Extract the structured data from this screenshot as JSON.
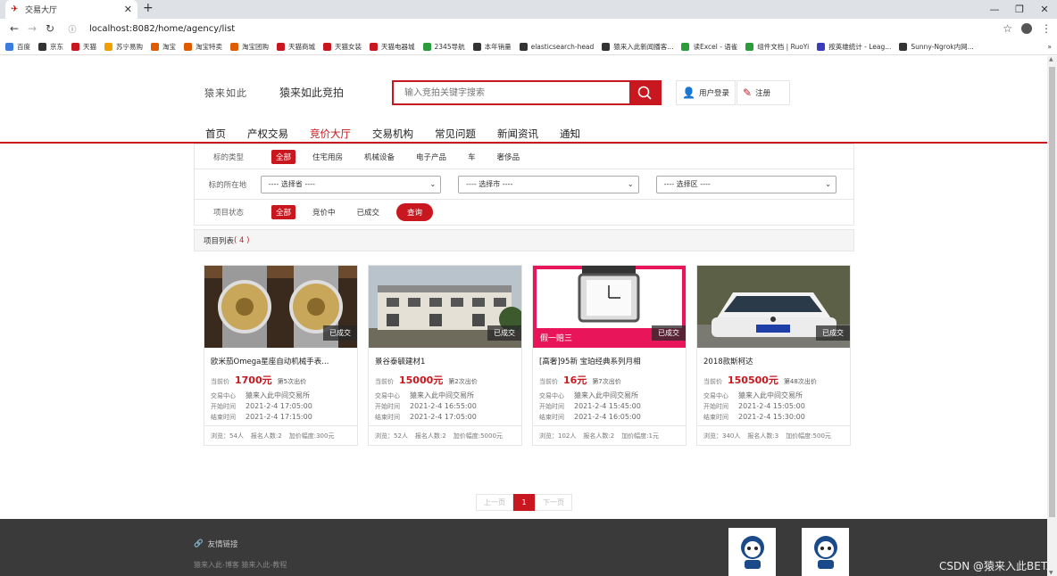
{
  "browser": {
    "tab_title": "交易大厅",
    "url": "localhost:8082/home/agency/list",
    "bookmarks": [
      "百度",
      "京东",
      "天猫",
      "苏宁易购",
      "淘宝",
      "淘宝特卖",
      "淘宝团购",
      "天猫商城",
      "天猫女装",
      "天猫电器城",
      "2345导航",
      "本年销量",
      "elasticsearch-head",
      "猿来入此新闻播客...",
      "读Excel - 语雀",
      "组件文档 | RuoYi",
      "按英雄统计 - Leag...",
      "Sunny-Ngrok内网..."
    ],
    "bookmarks_more": "»",
    "colors": {
      "accent": "#c8171e"
    }
  },
  "header": {
    "logo_text": "猿来如此",
    "site_name": "猿来如此竞拍",
    "search_placeholder": "输入竞拍关键字搜索",
    "login_label": "用户登录",
    "register_label": "注册"
  },
  "nav": [
    "首页",
    "产权交易",
    "竞价大厅",
    "交易机构",
    "常见问题",
    "新闻资讯",
    "通知"
  ],
  "filters": {
    "type_label": "标的类型",
    "types": [
      "全部",
      "住宅用房",
      "机械设备",
      "电子产品",
      "车",
      "奢侈品"
    ],
    "location_label": "标的所在地",
    "province": "---- 选择省 ----",
    "city": "---- 选择市 ----",
    "district": "---- 选择区 ----",
    "status_label": "项目状态",
    "statuses": [
      "全部",
      "竞价中",
      "已成交"
    ],
    "query_label": "查询"
  },
  "list": {
    "label": "项目列表",
    "count": "( 4 )"
  },
  "cards": [
    {
      "title": "欧米茄Omega星座自动机械手表...",
      "badge": "已成交",
      "price_label": "当前价",
      "price": "1700元",
      "bids": "第5次出价",
      "center_label": "交易中心",
      "center": "猿来入此中间交易所",
      "start_label": "开始时间",
      "start": "2021-2-4 17:05:00",
      "end_label": "结束时间",
      "end": "2021-2-4 17:15:00",
      "views": "浏览：54人",
      "signups": "报名人数:2",
      "step": "加价幅度:300元"
    },
    {
      "title": "景谷泰毓建材1",
      "badge": "已成交",
      "price_label": "当前价",
      "price": "15000元",
      "bids": "第2次出价",
      "center_label": "交易中心",
      "center": "猿来入此中间交易所",
      "start_label": "开始时间",
      "start": "2021-2-4 16:55:00",
      "end_label": "结束时间",
      "end": "2021-2-4 17:05:00",
      "views": "浏览：52人",
      "signups": "报名人数:2",
      "step": "加价幅度:5000元"
    },
    {
      "title": "[高奢]95新 宝珀经典系列月相",
      "badge": "已成交",
      "price_label": "当前价",
      "price": "16元",
      "bids": "第7次出价",
      "center_label": "交易中心",
      "center": "猿来入此中间交易所",
      "start_label": "开始时间",
      "start": "2021-2-4 15:45:00",
      "end_label": "结束时间",
      "end": "2021-2-4 16:05:00",
      "views": "浏览：102人",
      "signups": "报名人数:2",
      "step": "加价幅度:1元"
    },
    {
      "title": "2018款斯柯达",
      "badge": "已成交",
      "price_label": "当前价",
      "price": "150500元",
      "bids": "第48次出价",
      "center_label": "交易中心",
      "center": "猿来入此中间交易所",
      "start_label": "开始时间",
      "start": "2021-2-4 15:05:00",
      "end_label": "结束时间",
      "end": "2021-2-4 15:30:00",
      "views": "浏览：340人",
      "signups": "报名人数:3",
      "step": "加价幅度:500元"
    }
  ],
  "watch_ad_text": "假一赔三",
  "pager": {
    "prev": "上一页",
    "current": "1",
    "next": "下一页"
  },
  "footer": {
    "friend_links": "友情链接",
    "links": "猿来入此-博客  猿来入此-教程"
  },
  "watermark": "CSDN @猿来入此BETA"
}
